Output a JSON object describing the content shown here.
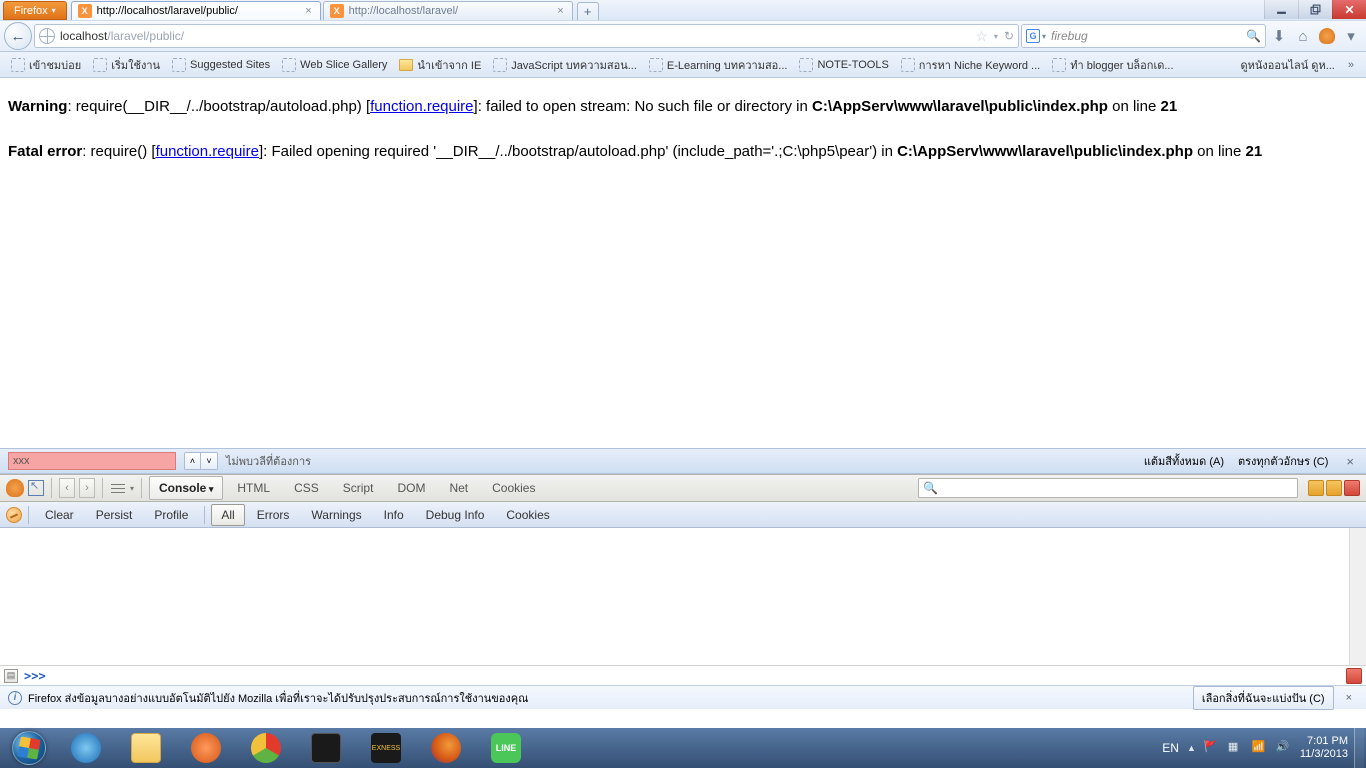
{
  "firefoxButton": "Firefox",
  "tabs": [
    {
      "title": "http://localhost/laravel/public/",
      "active": true,
      "closeable": true
    },
    {
      "title": "http://localhost/laravel/",
      "active": false,
      "closeable": true
    }
  ],
  "url": {
    "host": "localhost",
    "path": "/laravel/public/"
  },
  "search": {
    "engine": "G",
    "value": "firebug"
  },
  "bookmarks": [
    {
      "label": "เข้าชมบ่อย",
      "type": "page"
    },
    {
      "label": "เริ่มใช้งาน",
      "type": "page"
    },
    {
      "label": "Suggested Sites",
      "type": "page"
    },
    {
      "label": "Web Slice Gallery",
      "type": "page"
    },
    {
      "label": "นำเข้าจาก IE",
      "type": "folder"
    },
    {
      "label": "JavaScript บทความสอน...",
      "type": "page"
    },
    {
      "label": "E-Learning บทความสอ...",
      "type": "page"
    },
    {
      "label": "NOTE-TOOLS",
      "type": "page"
    },
    {
      "label": "การหา Niche Keyword ...",
      "type": "page"
    },
    {
      "label": "ทำ blogger บล็อกเด...",
      "type": "page"
    }
  ],
  "bookmarksRight": "ดูหนังออนไลน์ ดูห...",
  "error1": {
    "label": "Warning",
    "pre": ": require(__DIR__/../bootstrap/autoload.php) [",
    "link": "function.require",
    "post": "]: failed to open stream: No such file or directory in ",
    "file": "C:\\AppServ\\www\\laravel\\public\\index.php",
    "online": " on line ",
    "line": "21"
  },
  "error2": {
    "label": "Fatal error",
    "pre": ": require() [",
    "link": "function.require",
    "post": "]: Failed opening required '__DIR__/../bootstrap/autoload.php' (include_path='.;C:\\php5\\pear') in ",
    "file": "C:\\AppServ\\www\\laravel\\public\\index.php",
    "online": " on line ",
    "line": "21"
  },
  "findbar": {
    "input": "xxx",
    "notfound": "ไม่พบวลีที่ต้องการ",
    "highlight": "แต้มสีทั้งหมด (A)",
    "matchcase": "ตรงทุกตัวอักษร (C)"
  },
  "firebug": {
    "tabs": [
      "Console",
      "HTML",
      "CSS",
      "Script",
      "DOM",
      "Net",
      "Cookies"
    ],
    "activeTab": "Console",
    "subitems": [
      "Clear",
      "Persist",
      "Profile",
      "All",
      "Errors",
      "Warnings",
      "Info",
      "Debug Info",
      "Cookies"
    ],
    "activeSub": "All",
    "prompt": ">>>"
  },
  "infobar": {
    "text": "Firefox ส่งข้อมูลบางอย่างแบบอัตโนมัติไปยัง Mozilla เพื่อที่เราจะได้ปรับปรุงประสบการณ์การใช้งานของคุณ",
    "button": "เลือกสิ่งที่ฉันจะแบ่งปัน (C)"
  },
  "systray": {
    "lang": "EN",
    "time": "7:01 PM",
    "date": "11/3/2013"
  }
}
